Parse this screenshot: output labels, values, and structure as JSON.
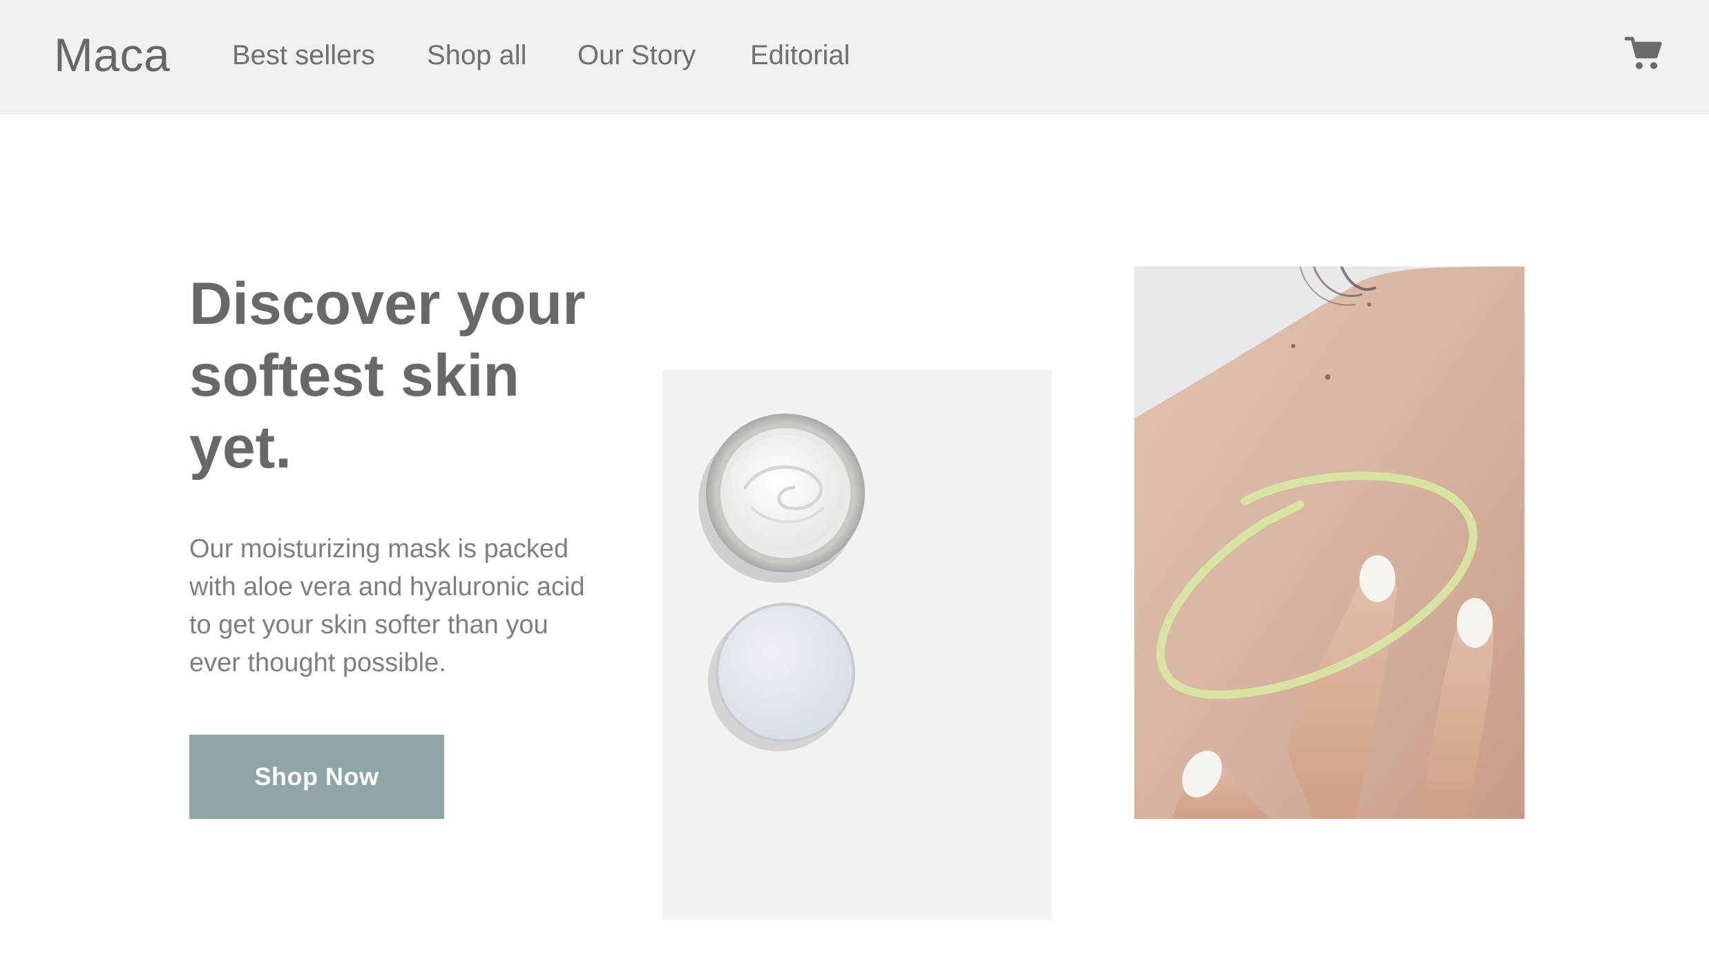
{
  "header": {
    "logo": "Maca",
    "nav": [
      {
        "label": "Best sellers"
      },
      {
        "label": "Shop all"
      },
      {
        "label": "Our Story"
      },
      {
        "label": "Editorial"
      }
    ],
    "cart_icon": "shopping-cart-icon"
  },
  "hero": {
    "headline": "Discover your softest skin yet.",
    "body": "Our moisturizing mask is packed with aloe vera and hyaluronic acid to get your skin softer than you ever thought possible.",
    "cta_label": "Shop Now"
  },
  "images": {
    "product": "moisturizing-mask-jar-and-lid",
    "model": "model-applying-cream-to-shoulder"
  },
  "colors": {
    "header_bg": "#f0f0f0",
    "text": "#686868",
    "body_text": "#7e7e7e",
    "button_bg": "#90a6a6",
    "button_text": "#ffffff",
    "product_panel_bg": "#f2f2f2",
    "highlight_circle": "#d8e6a2"
  }
}
